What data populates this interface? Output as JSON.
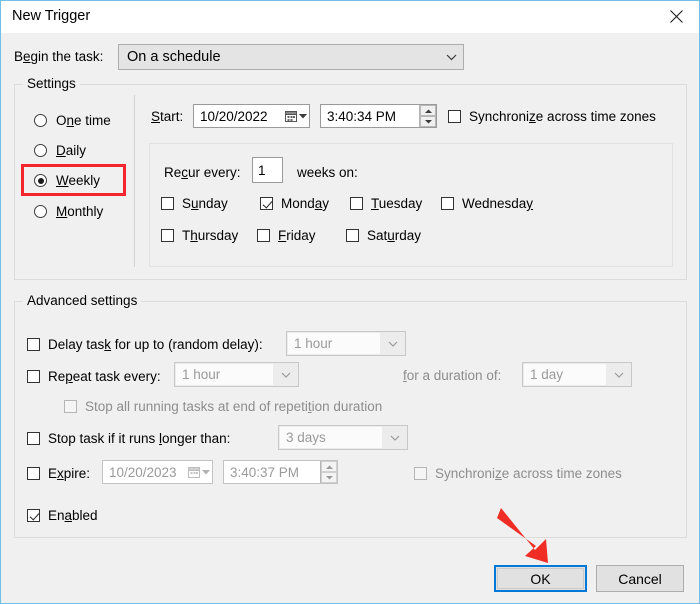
{
  "window": {
    "title": "New Trigger",
    "close_icon": "close-icon"
  },
  "begin": {
    "label_pre": "B",
    "label_acc": "e",
    "label_post": "gin the task:",
    "value": "On a schedule"
  },
  "settings": {
    "legend": "Settings",
    "schedule_options": [
      {
        "label_pre": "O",
        "label_acc": "n",
        "label_post": "e time",
        "selected": false,
        "name": "one-time"
      },
      {
        "label_pre": "",
        "label_acc": "D",
        "label_post": "aily",
        "selected": false,
        "name": "daily"
      },
      {
        "label_pre": "",
        "label_acc": "W",
        "label_post": "eekly",
        "selected": true,
        "name": "weekly"
      },
      {
        "label_pre": "",
        "label_acc": "M",
        "label_post": "onthly",
        "selected": false,
        "name": "monthly"
      }
    ],
    "start": {
      "label_pre": "",
      "label_acc": "S",
      "label_post": "tart:",
      "date": "10/20/2022",
      "time": "3:40:34 PM"
    },
    "sync_tz": {
      "pre": "Synchroni",
      "acc": "z",
      "post": "e across time zones",
      "checked": false
    },
    "recur": {
      "label_pre": "Re",
      "label_acc": "c",
      "label_post": "ur every:",
      "value": "1",
      "suffix": "weeks on:"
    },
    "days": [
      {
        "pre": "S",
        "acc": "u",
        "post": "nday",
        "checked": false,
        "name": "sunday"
      },
      {
        "pre": "Mond",
        "acc": "a",
        "post": "y",
        "checked": true,
        "name": "monday"
      },
      {
        "pre": "",
        "acc": "T",
        "post": "uesday",
        "checked": false,
        "name": "tuesday"
      },
      {
        "pre": "Wednesda",
        "acc": "y",
        "post": "",
        "checked": false,
        "name": "wednesday"
      },
      {
        "pre": "T",
        "acc": "h",
        "post": "ursday",
        "checked": false,
        "name": "thursday"
      },
      {
        "pre": "",
        "acc": "F",
        "post": "riday",
        "checked": false,
        "name": "friday"
      },
      {
        "pre": "Sat",
        "acc": "u",
        "post": "rday",
        "checked": false,
        "name": "saturday"
      }
    ]
  },
  "advanced": {
    "legend": "Advanced settings",
    "delay": {
      "pre": "Delay tas",
      "acc": "k",
      "post": " for up to (random delay):",
      "checked": false,
      "value": "1 hour",
      "enabled": false
    },
    "repeat": {
      "pre": "Re",
      "acc": "p",
      "post": "eat task every:",
      "checked": false,
      "value": "1 hour",
      "duration_label_pre": "",
      "duration_label_acc": "f",
      "duration_label_post": "or a duration of:",
      "duration_value": "1 day",
      "enabled": false
    },
    "stop_repetition": {
      "pre": "Stop all running tasks at end of repeti",
      "acc": "t",
      "post": "ion duration",
      "checked": false,
      "enabled": false
    },
    "stop_longer": {
      "pre": "Stop task if it runs ",
      "acc": "l",
      "post": "onger than:",
      "checked": false,
      "value": "3 days",
      "enabled": false
    },
    "expire": {
      "pre": "E",
      "acc": "x",
      "post": "pire:",
      "checked": false,
      "date": "10/20/2023",
      "time": "3:40:37 PM",
      "sync_pre": "Synchroni",
      "sync_acc": "z",
      "sync_post": "e across time zones",
      "sync_checked": false
    },
    "enabled": {
      "pre": "En",
      "acc": "a",
      "post": "bled",
      "checked": true
    }
  },
  "footer": {
    "ok": "OK",
    "cancel": "Cancel"
  },
  "annotations": {
    "highlight_color": "#f5252d",
    "arrow_color": "#ef2d24",
    "focus_color": "#0078d7"
  }
}
